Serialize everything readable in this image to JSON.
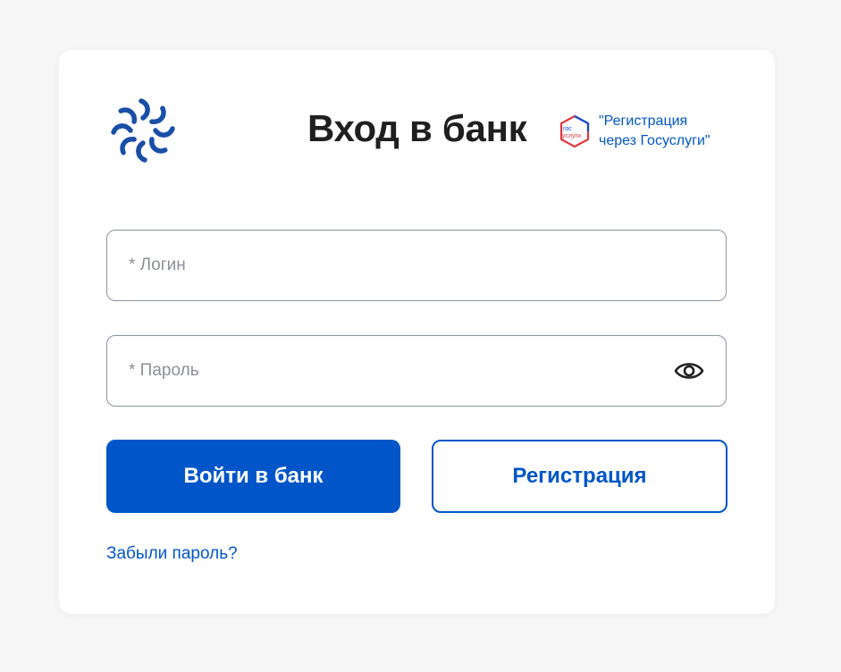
{
  "header": {
    "title": "Вход в банк",
    "logo_icon": "bank-flower-logo-icon",
    "gosuslugi": {
      "icon": "gosuslugi-logo-icon",
      "icon_text_top": "гос",
      "icon_text_bottom": "услуги",
      "line1": "\"Регистрация",
      "line2": "через Госуслуги\""
    }
  },
  "form": {
    "login_placeholder": "* Логин",
    "login_value": "",
    "password_placeholder": "* Пароль",
    "password_value": "",
    "show_password_icon": "eye-icon"
  },
  "actions": {
    "login_button": "Войти в банк",
    "register_button": "Регистрация",
    "forgot_password": "Забыли пароль?"
  },
  "colors": {
    "accent": "#0056c8",
    "title": "#1f1f1f",
    "border": "#8c93a0",
    "background": "#f6f6f7",
    "card": "#ffffff",
    "gos_red": "#e0393e",
    "gos_blue": "#0d4cd3"
  }
}
